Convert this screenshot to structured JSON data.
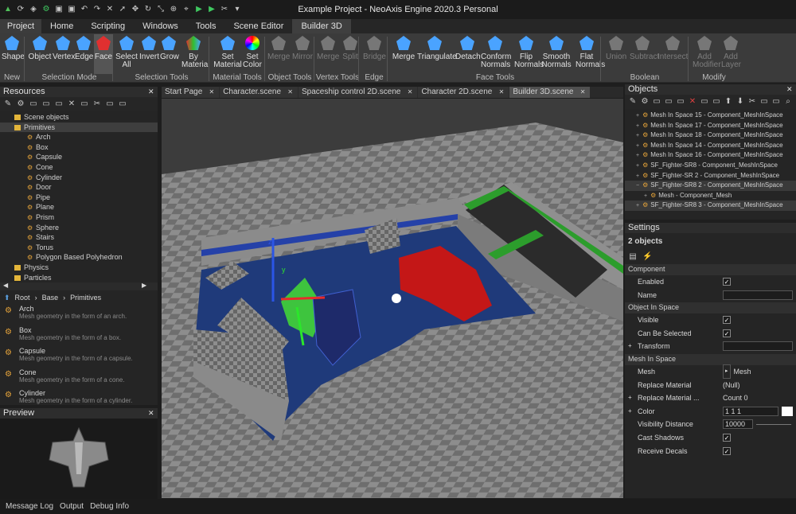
{
  "window": {
    "title": "Example Project - NeoAxis Engine 2020.3 Personal"
  },
  "ribbon_tabs": [
    "Project",
    "Home",
    "Scripting",
    "Windows",
    "Tools",
    "Scene Editor",
    "Builder 3D"
  ],
  "ribbon": {
    "buttons": [
      {
        "l1": "Shape",
        "l2": ""
      },
      {
        "l1": "Object",
        "l2": ""
      },
      {
        "l1": "Vertex",
        "l2": ""
      },
      {
        "l1": "Edge",
        "l2": ""
      },
      {
        "l1": "Face",
        "l2": ""
      },
      {
        "l1": "Select",
        "l2": "All"
      },
      {
        "l1": "Invert",
        "l2": ""
      },
      {
        "l1": "Grow",
        "l2": ""
      },
      {
        "l1": "By",
        "l2": "Material"
      },
      {
        "l1": "Set",
        "l2": "Material"
      },
      {
        "l1": "Set",
        "l2": "Color"
      },
      {
        "l1": "Merge",
        "l2": ""
      },
      {
        "l1": "Mirror",
        "l2": ""
      },
      {
        "l1": "Merge",
        "l2": ""
      },
      {
        "l1": "Split",
        "l2": ""
      },
      {
        "l1": "Bridge",
        "l2": ""
      },
      {
        "l1": "Merge",
        "l2": ""
      },
      {
        "l1": "Triangulate",
        "l2": ""
      },
      {
        "l1": "Detach",
        "l2": ""
      },
      {
        "l1": "Conform",
        "l2": "Normals"
      },
      {
        "l1": "Flip",
        "l2": "Normals"
      },
      {
        "l1": "Smooth",
        "l2": "Normals"
      },
      {
        "l1": "Flat",
        "l2": "Normals"
      },
      {
        "l1": "Union",
        "l2": ""
      },
      {
        "l1": "Subtract",
        "l2": ""
      },
      {
        "l1": "Intersect",
        "l2": ""
      },
      {
        "l1": "Add",
        "l2": "Modifier"
      },
      {
        "l1": "Add",
        "l2": "Layer"
      }
    ],
    "groups": [
      "New",
      "Selection Mode",
      "Selection Tools",
      "Material Tools",
      "Object Tools",
      "Vertex Tools",
      "Edge",
      "Face Tools",
      "Boolean",
      "Modify"
    ]
  },
  "resources": {
    "title": "Resources",
    "items": [
      "Scene objects",
      "Primitives",
      "Arch",
      "Box",
      "Capsule",
      "Cone",
      "Cylinder",
      "Door",
      "Pipe",
      "Plane",
      "Prism",
      "Sphere",
      "Stairs",
      "Torus",
      "Polygon Based Polyhedron",
      "Physics",
      "Particles"
    ],
    "breadcrumb": [
      "Root",
      "Base",
      "Primitives"
    ],
    "list": [
      {
        "name": "Arch",
        "desc": "Mesh geometry in the form of an arch."
      },
      {
        "name": "Box",
        "desc": "Mesh geometry in the form of a box."
      },
      {
        "name": "Capsule",
        "desc": "Mesh geometry in the form of a capsule."
      },
      {
        "name": "Cone",
        "desc": "Mesh geometry in the form of a cone."
      },
      {
        "name": "Cylinder",
        "desc": "Mesh geometry in the form of a cylinder."
      }
    ]
  },
  "preview": {
    "title": "Preview"
  },
  "doc_tabs": [
    "Start Page",
    "Character.scene",
    "Spaceship control 2D.scene",
    "Character 2D.scene",
    "Builder 3D.scene"
  ],
  "objects": {
    "title": "Objects",
    "rows": [
      "Mesh In Space 15 - Component_MeshInSpace",
      "Mesh In Space 17 - Component_MeshInSpace",
      "Mesh In Space 18 - Component_MeshInSpace",
      "Mesh In Space 14 - Component_MeshInSpace",
      "Mesh In Space 16 - Component_MeshInSpace",
      "SF_Fighter-SR8 - Component_MeshInSpace",
      "SF_Fighter-SR 2 - Component_MeshInSpace",
      "SF_Fighter-SR8 2 - Component_MeshInSpace",
      "Mesh - Component_Mesh",
      "SF_Fighter-SR8 3 - Component_MeshInSpace"
    ]
  },
  "settings": {
    "title": "Settings",
    "count": "2 objects",
    "sections": {
      "component": "Component",
      "object_in_space": "Object In Space",
      "mesh_in_space": "Mesh In Space"
    },
    "props": {
      "enabled": "Enabled",
      "name": "Name",
      "visible": "Visible",
      "can_be_selected": "Can Be Selected",
      "transform": "Transform",
      "mesh": "Mesh",
      "mesh_val": "Mesh",
      "replace_material": "Replace Material",
      "replace_material_val": "(Null)",
      "replace_material2": "Replace Material ...",
      "replace_material2_val": "Count 0",
      "color": "Color",
      "color_val": "1 1 1",
      "visibility_distance": "Visibility Distance",
      "visibility_distance_val": "10000",
      "cast_shadows": "Cast Shadows",
      "receive_decals": "Receive Decals"
    }
  },
  "status": [
    "Message Log",
    "Output",
    "Debug Info"
  ],
  "colors": {
    "accent": "#3b7bd6",
    "selection": "#4a4a4a"
  }
}
